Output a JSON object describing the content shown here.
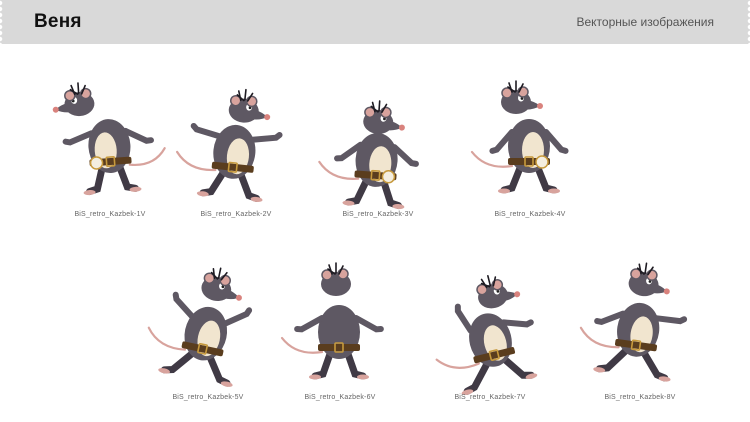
{
  "header": {
    "title": "Веня",
    "subtitle": "Векторные изображения"
  },
  "colors": {
    "header_bg": "#d9d9d9",
    "fur": "#5e5863",
    "fur_dark": "#403a45",
    "belly": "#f1e5cf",
    "belt": "#5a3d1e",
    "buckle": "#c79a3d",
    "nose": "#d9827d",
    "tail": "#d8a39d"
  },
  "figures": [
    {
      "caption": "BiS_retro_Kazbek-1V",
      "pose": "standing-hands-on-hips"
    },
    {
      "caption": "BiS_retro_Kazbek-2V",
      "pose": "waving-right"
    },
    {
      "caption": "BiS_retro_Kazbek-3V",
      "pose": "leaning-side"
    },
    {
      "caption": "BiS_retro_Kazbek-4V",
      "pose": "arms-crossed"
    },
    {
      "caption": "BiS_retro_Kazbek-5V",
      "pose": "dancing-arms-out"
    },
    {
      "caption": "BiS_retro_Kazbek-6V",
      "pose": "back-view"
    },
    {
      "caption": "BiS_retro_Kazbek-7V",
      "pose": "reaching-up"
    },
    {
      "caption": "BiS_retro_Kazbek-8V",
      "pose": "walking"
    }
  ]
}
